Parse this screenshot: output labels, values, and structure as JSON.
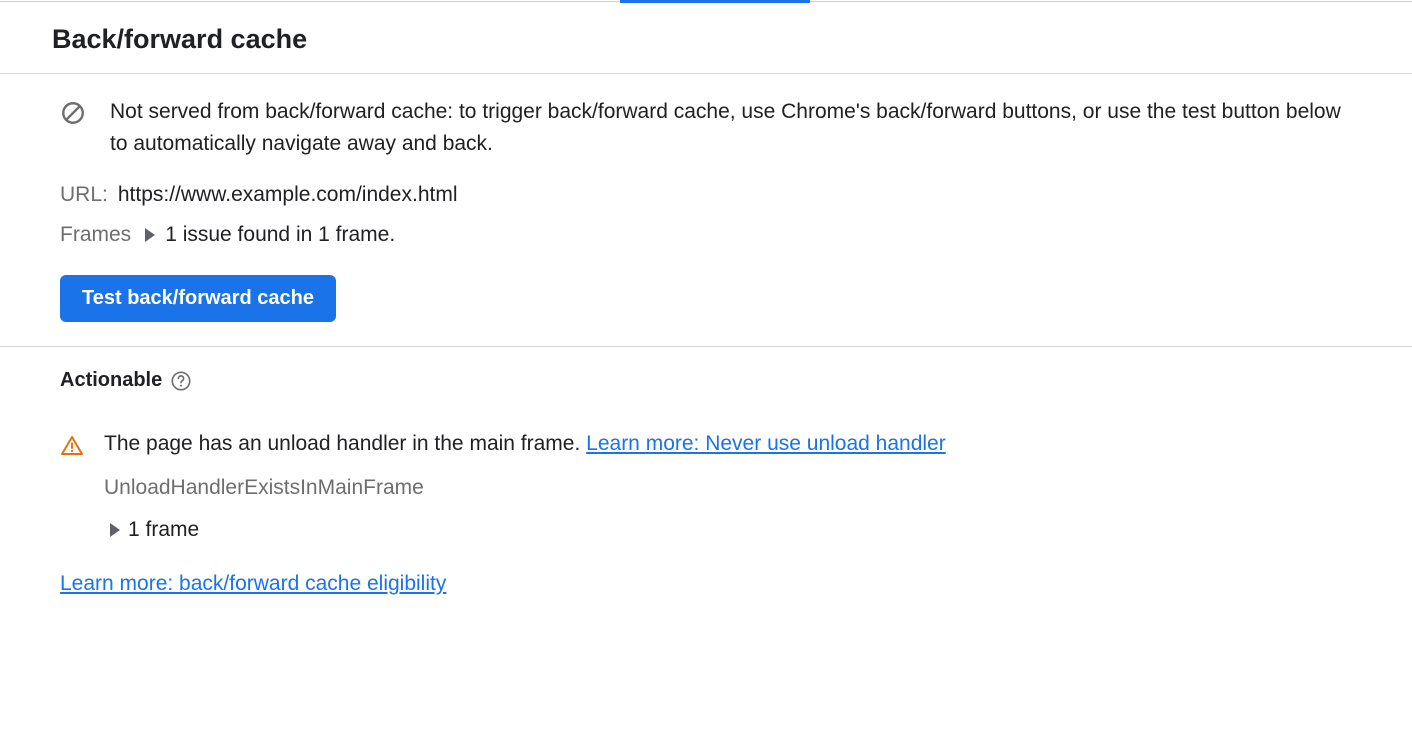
{
  "header": {
    "title": "Back/forward cache"
  },
  "info": {
    "message": "Not served from back/forward cache: to trigger back/forward cache, use Chrome's back/forward buttons, or use the test button below to automatically navigate away and back."
  },
  "url": {
    "label": "URL:",
    "value": "https://www.example.com/index.html"
  },
  "frames": {
    "label": "Frames",
    "summary": "1 issue found in 1 frame."
  },
  "actions": {
    "test_button": "Test back/forward cache"
  },
  "actionable": {
    "heading": "Actionable",
    "issue": {
      "text": "The page has an unload handler in the main frame. ",
      "learn_more": "Learn more: Never use unload handler",
      "code": "UnloadHandlerExistsInMainFrame",
      "frame_count": "1 frame"
    },
    "eligibility_link": "Learn more: back/forward cache eligibility"
  }
}
